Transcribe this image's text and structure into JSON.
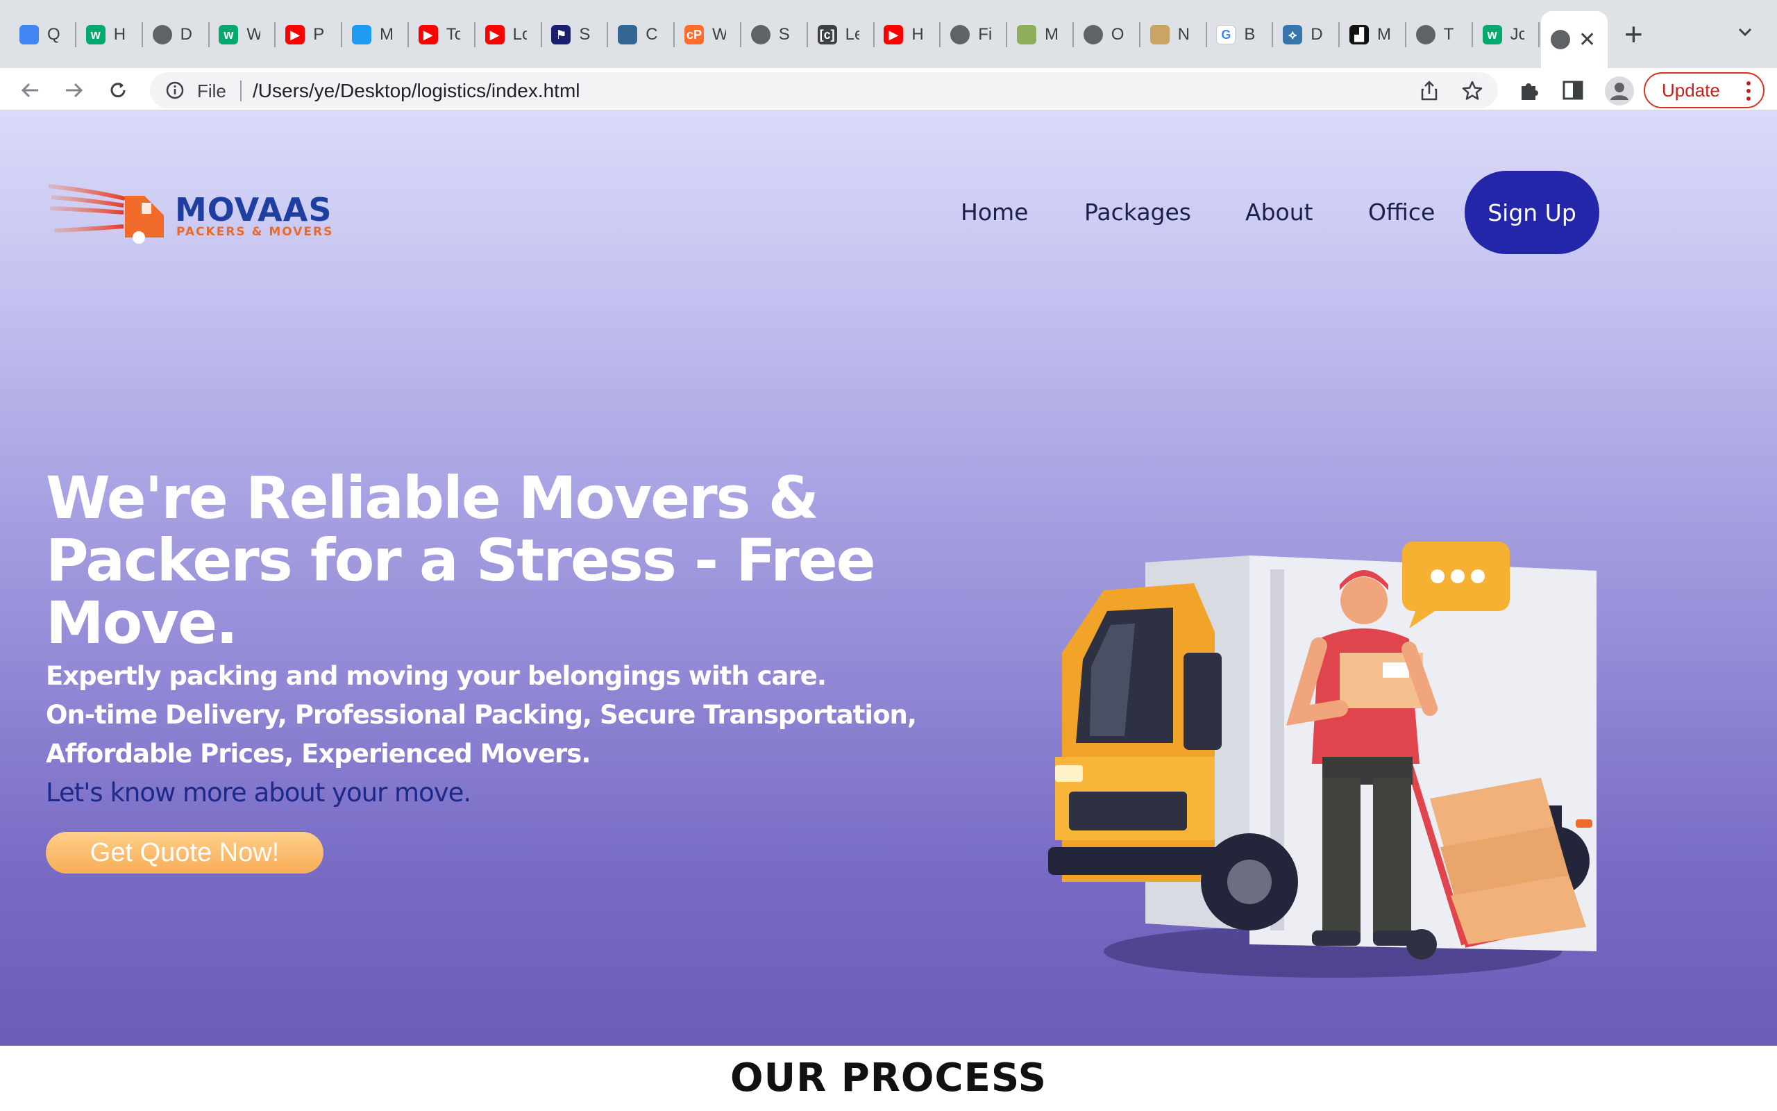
{
  "browser": {
    "tabs": [
      {
        "title": "Q",
        "icon": "colorful-grid-icon"
      },
      {
        "title": "H",
        "icon": "w3schools-icon"
      },
      {
        "title": "D",
        "icon": "globe-icon"
      },
      {
        "title": "W",
        "icon": "w3schools-icon"
      },
      {
        "title": "P",
        "icon": "youtube-icon"
      },
      {
        "title": "M",
        "icon": "bird-icon"
      },
      {
        "title": "To",
        "icon": "youtube-icon"
      },
      {
        "title": "Lo",
        "icon": "youtube-icon"
      },
      {
        "title": "S",
        "icon": "bookmark-icon"
      },
      {
        "title": "C",
        "icon": "postgres-icon"
      },
      {
        "title": "W",
        "icon": "cpanel-icon"
      },
      {
        "title": "S",
        "icon": "globe-icon"
      },
      {
        "title": "Le",
        "icon": "code-icon"
      },
      {
        "title": "H",
        "icon": "youtube-icon"
      },
      {
        "title": "Fi",
        "icon": "globe-icon"
      },
      {
        "title": "M",
        "icon": "money-icon"
      },
      {
        "title": "O",
        "icon": "globe-icon"
      },
      {
        "title": "N",
        "icon": "coin-icon"
      },
      {
        "title": "B",
        "icon": "google-icon"
      },
      {
        "title": "D",
        "icon": "python-icon"
      },
      {
        "title": "M",
        "icon": "block-icon"
      },
      {
        "title": "T",
        "icon": "globe-icon"
      },
      {
        "title": "Jc",
        "icon": "w3schools-icon"
      }
    ],
    "active_tab": {
      "title": "",
      "icon": "globe-icon"
    },
    "address": {
      "scheme": "File",
      "url": "/Users/ye/Desktop/logistics/index.html"
    },
    "update_label": "Update"
  },
  "site": {
    "logo": {
      "name": "MOVAAS",
      "tagline": "PACKERS & MOVERS"
    },
    "nav": [
      "Home",
      "Packages",
      "About",
      "Office"
    ],
    "signup_label": "Sign Up",
    "hero": {
      "headline_lines": [
        "We're Reliable Movers &",
        "Packers for a Stress - Free",
        "Move."
      ],
      "sub_lines": [
        "Expertly packing and moving your belongings with care.",
        "On-time Delivery, Professional Packing, Secure Transportation,",
        "Affordable Prices, Experienced Movers."
      ],
      "cta_text": "Let's know more about your move.",
      "cta_button": "Get Quote Now!"
    },
    "section_title": "OUR PROCESS"
  },
  "colors": {
    "brand_blue": "#1e3fa0",
    "brand_orange": "#ea6a2a",
    "signup_bg": "#2326a8",
    "cta_orange": "#f7ad57"
  }
}
